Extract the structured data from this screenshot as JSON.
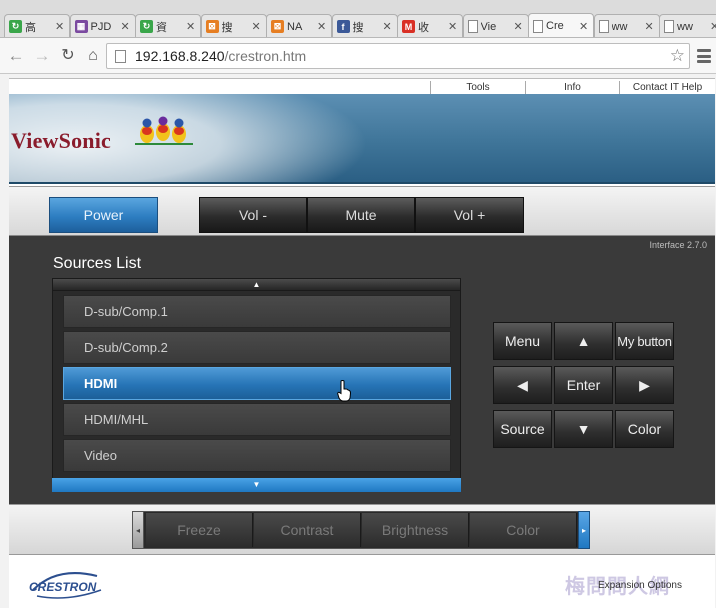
{
  "browser": {
    "tabs": [
      {
        "label": "高",
        "fav_color": "#3aa64a",
        "fav_glyph": "↻"
      },
      {
        "label": "PJD",
        "fav_color": "#7b4aa0",
        "fav_glyph": "▦"
      },
      {
        "label": "資",
        "fav_color": "#3aa64a",
        "fav_glyph": "↻"
      },
      {
        "label": "搜",
        "fav_color": "#e67e22",
        "fav_glyph": "⊠"
      },
      {
        "label": "NA",
        "fav_color": "#e67e22",
        "fav_glyph": "⊠"
      },
      {
        "label": "搜",
        "fav_color": "#3b5998",
        "fav_glyph": "f"
      },
      {
        "label": "收",
        "fav_color": "#d93025",
        "fav_glyph": "M"
      },
      {
        "label": "Vie",
        "fav_color": "#ffffff",
        "fav_glyph": ""
      },
      {
        "label": "Cre",
        "fav_color": "#ffffff",
        "fav_glyph": "",
        "active": true
      },
      {
        "label": "ww",
        "fav_color": "#ffffff",
        "fav_glyph": ""
      },
      {
        "label": "ww",
        "fav_color": "#ffffff",
        "fav_glyph": ""
      }
    ],
    "url_host": "192.168.8.240",
    "url_path": "/crestron.htm"
  },
  "topnav": {
    "tools": "Tools",
    "info": "Info",
    "contact": "Contact IT Help"
  },
  "banner": {
    "logo": "ViewSonic"
  },
  "controls": {
    "power": "Power",
    "vol_down": "Vol -",
    "mute": "Mute",
    "vol_up": "Vol +"
  },
  "interface_version": "Interface 2.7.0",
  "sources": {
    "title": "Sources List",
    "up_arrow": "▲",
    "down_arrow": "▼",
    "items": [
      "D-sub/Comp.1",
      "D-sub/Comp.2",
      "HDMI",
      "HDMI/MHL",
      "Video"
    ],
    "selected": "HDMI"
  },
  "keypad": {
    "menu": "Menu",
    "up": "▲",
    "my_button": "My button",
    "left": "◀",
    "enter": "Enter",
    "right": "▶",
    "source": "Source",
    "down": "▼",
    "color": "Color"
  },
  "expansion": {
    "left_arrow": "◂",
    "right_arrow": "▸",
    "buttons": [
      "Freeze",
      "Contrast",
      "Brightness",
      "Color"
    ]
  },
  "footer": {
    "brand": "CRESTRON",
    "expansion_options": "Expansion Options",
    "watermark": "梅問問人網"
  },
  "colors": {
    "accent_blue": "#2674b6",
    "logo_red": "#8a1c2c"
  }
}
